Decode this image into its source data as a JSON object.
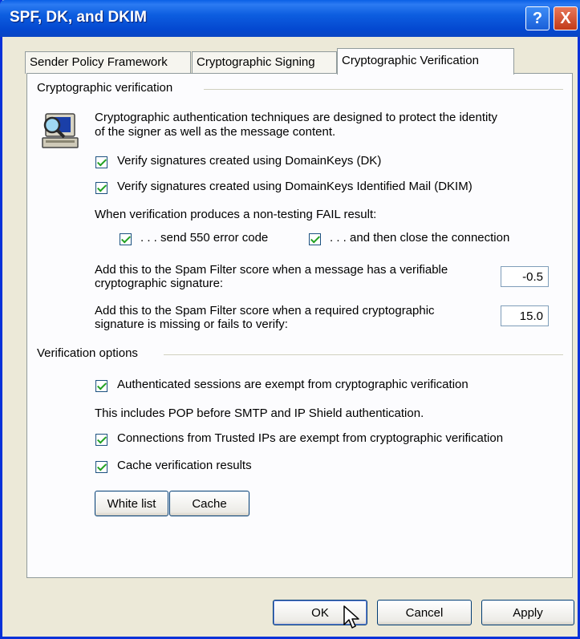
{
  "window": {
    "title": "SPF, DK, and DKIM",
    "help_label": "?",
    "close_label": "X"
  },
  "tabs": [
    {
      "label": "Sender Policy Framework",
      "active": false
    },
    {
      "label": "Cryptographic Signing",
      "active": false
    },
    {
      "label": "Cryptographic Verification",
      "active": true
    }
  ],
  "verification": {
    "group_title": "Cryptographic verification",
    "description_line1": "Cryptographic authentication techniques are designed to protect the identity",
    "description_line2": "of the signer as well as the message content.",
    "verify_dk": {
      "label": "Verify signatures created using DomainKeys (DK)",
      "checked": true
    },
    "verify_dkim": {
      "label": "Verify signatures created using DomainKeys Identified Mail (DKIM)",
      "checked": true
    },
    "fail_heading": "When verification produces a non-testing FAIL result:",
    "send_550": {
      "label": ". . . send 550 error code",
      "checked": true
    },
    "close_connection": {
      "label": ". . . and then close the connection",
      "checked": true
    },
    "verifiable_score": {
      "label_line1": "Add this to the Spam Filter score when a message has a verifiable",
      "label_line2": "cryptographic signature:",
      "value": "-0.5"
    },
    "missing_score": {
      "label_line1": "Add this to the Spam Filter score when a required cryptographic",
      "label_line2": "signature is missing or fails to verify:",
      "value": "15.0"
    }
  },
  "options": {
    "group_title": "Verification options",
    "auth_exempt": {
      "label": "Authenticated sessions are exempt from cryptographic verification",
      "checked": true
    },
    "auth_note": "This includes POP before SMTP and IP Shield authentication.",
    "trusted_exempt": {
      "label": "Connections from Trusted IPs are exempt from cryptographic verification",
      "checked": true
    },
    "cache_results": {
      "label": "Cache verification results",
      "checked": true
    },
    "white_list_label": "White list",
    "cache_label": "Cache"
  },
  "footer": {
    "ok_label": "OK",
    "cancel_label": "Cancel",
    "apply_label": "Apply"
  },
  "colors": {
    "title_bar": "#0a5fe6",
    "window_border": "#0831d9",
    "dialog_bg": "#ece9d8",
    "check": "#21a121"
  },
  "icons": {
    "computer": "computer-magnifier-icon",
    "cursor": "mouse-pointer-icon"
  }
}
